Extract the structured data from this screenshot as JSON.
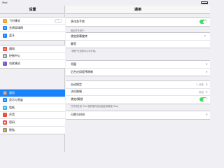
{
  "status": {
    "carrier": "iPad"
  },
  "sidebar": {
    "title": "设置",
    "items": [
      {
        "label": "飞行模式",
        "icon": "airplane-icon",
        "color": "#f79c1d",
        "glyph": "✈",
        "toggle": "off"
      },
      {
        "label": "无线局域网",
        "icon": "wifi-icon",
        "color": "#1a82fb",
        "glyph": "≋"
      },
      {
        "label": "蓝牙",
        "icon": "bluetooth-icon",
        "color": "#1a82fb",
        "glyph": "ᛒ"
      },
      {
        "label": "通知",
        "icon": "notifications-icon",
        "color": "#e9443a",
        "glyph": "▤"
      },
      {
        "label": "控制中心",
        "icon": "control-center-icon",
        "color": "#8e8e93",
        "glyph": "◉"
      },
      {
        "label": "勿扰模式",
        "icon": "do-not-disturb-icon",
        "color": "#6a5acd",
        "glyph": "☾"
      },
      {
        "label": "通用",
        "icon": "gear-icon",
        "color": "#8e8e93",
        "glyph": "⚙"
      },
      {
        "label": "显示与亮度",
        "icon": "display-icon",
        "color": "#1a82fb",
        "glyph": "A"
      },
      {
        "label": "墙纸",
        "icon": "wallpaper-icon",
        "color": "#33b5e5",
        "glyph": "❀"
      },
      {
        "label": "声音",
        "icon": "sound-icon",
        "color": "#e9443a",
        "glyph": "♪"
      },
      {
        "label": "密码",
        "icon": "passcode-icon",
        "color": "#e9443a",
        "glyph": "▣"
      },
      {
        "label": "隐私",
        "icon": "privacy-icon",
        "color": "#8e8e93",
        "glyph": "✋"
      }
    ]
  },
  "main": {
    "title": "通用",
    "multitasking": "多任务手势",
    "side_switch_header": "侧边开关用于：",
    "lock_rotation": "锁定屏幕旋转",
    "mute": "静音",
    "rotation_footnote": "\"静音\"在控制中心中可用。",
    "usage": "用量",
    "background_refresh": "后台应用程序刷新",
    "auto_lock": "自动锁定",
    "auto_lock_value": "2 分钟",
    "restrictions": "访问限制",
    "restrictions_value": "关闭",
    "lock_unlock": "锁定/解锁",
    "lock_footnote": "打开和关闭 iPad 保护套时自动锁定和解锁 iPad。",
    "date_time": "日期与时间"
  },
  "colors": {
    "accent": "#1a82fb",
    "toggle_on": "#4cd964"
  }
}
